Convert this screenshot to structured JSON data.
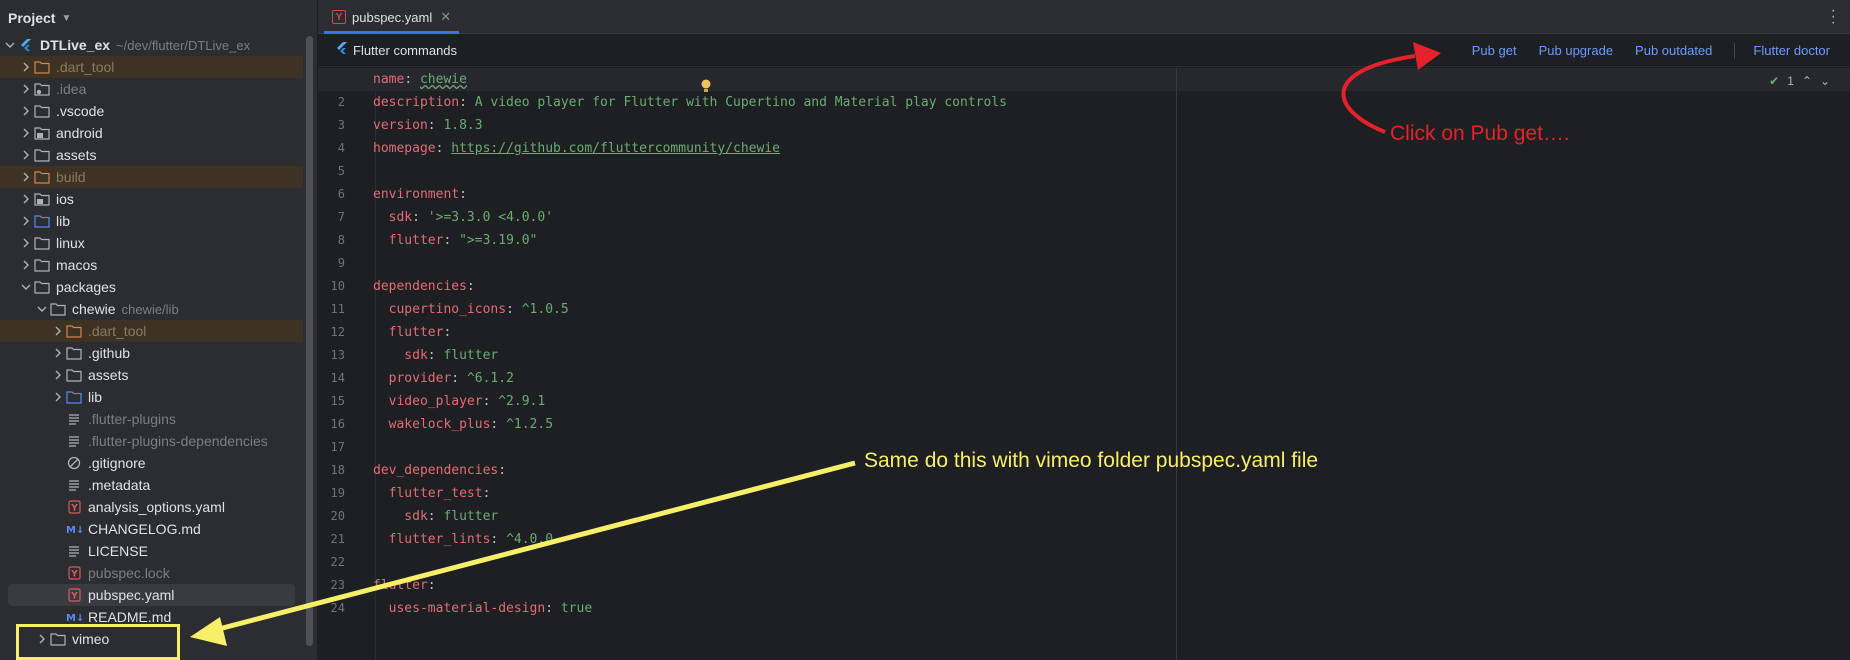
{
  "project_panel": {
    "title": "Project",
    "root_name": "DTLive_ex",
    "root_path": "~/dev/flutter/DTLive_ex",
    "items": [
      {
        "label": ".dart_tool",
        "depth": 1,
        "type": "folder-excluded",
        "arrow": "right",
        "style": "dim",
        "hl": true
      },
      {
        "label": ".idea",
        "depth": 1,
        "type": "folder-settings",
        "arrow": "right",
        "style": "grey"
      },
      {
        "label": ".vscode",
        "depth": 1,
        "type": "folder",
        "arrow": "right"
      },
      {
        "label": "android",
        "depth": 1,
        "type": "folder-module",
        "arrow": "right"
      },
      {
        "label": "assets",
        "depth": 1,
        "type": "folder",
        "arrow": "right"
      },
      {
        "label": "build",
        "depth": 1,
        "type": "folder-excluded",
        "arrow": "right",
        "style": "dim",
        "hl": true
      },
      {
        "label": "ios",
        "depth": 1,
        "type": "folder-module",
        "arrow": "right"
      },
      {
        "label": "lib",
        "depth": 1,
        "type": "folder-source",
        "arrow": "right"
      },
      {
        "label": "linux",
        "depth": 1,
        "type": "folder",
        "arrow": "right"
      },
      {
        "label": "macos",
        "depth": 1,
        "type": "folder",
        "arrow": "right"
      },
      {
        "label": "packages",
        "depth": 1,
        "type": "folder",
        "arrow": "down"
      },
      {
        "label": "chewie",
        "hint": "chewie/lib",
        "depth": 2,
        "type": "folder",
        "arrow": "down"
      },
      {
        "label": ".dart_tool",
        "depth": 3,
        "type": "folder-excluded",
        "arrow": "right",
        "style": "dim",
        "hl": true
      },
      {
        "label": ".github",
        "depth": 3,
        "type": "folder",
        "arrow": "right"
      },
      {
        "label": "assets",
        "depth": 3,
        "type": "folder",
        "arrow": "right"
      },
      {
        "label": "lib",
        "depth": 3,
        "type": "folder-source",
        "arrow": "right"
      },
      {
        "label": ".flutter-plugins",
        "depth": 3,
        "type": "file-text",
        "style": "grey"
      },
      {
        "label": ".flutter-plugins-dependencies",
        "depth": 3,
        "type": "file-text",
        "style": "grey"
      },
      {
        "label": ".gitignore",
        "depth": 3,
        "type": "file-ignore"
      },
      {
        "label": ".metadata",
        "depth": 3,
        "type": "file-text"
      },
      {
        "label": "analysis_options.yaml",
        "depth": 3,
        "type": "file-yaml"
      },
      {
        "label": "CHANGELOG.md",
        "depth": 3,
        "type": "file-md"
      },
      {
        "label": "LICENSE",
        "depth": 3,
        "type": "file-text"
      },
      {
        "label": "pubspec.lock",
        "depth": 3,
        "type": "file-yaml",
        "style": "grey"
      },
      {
        "label": "pubspec.yaml",
        "depth": 3,
        "type": "file-yaml",
        "selected": true
      },
      {
        "label": "README.md",
        "depth": 3,
        "type": "file-md"
      },
      {
        "label": "vimeo",
        "depth": 2,
        "type": "folder",
        "arrow": "right"
      }
    ]
  },
  "editor": {
    "tab_label": "pubspec.yaml",
    "commands_title": "Flutter commands",
    "commands": [
      "Pub get",
      "Pub upgrade",
      "Pub outdated"
    ],
    "doctor": "Flutter doctor",
    "inspection_count": "1",
    "lines": [
      [
        {
          "t": "name",
          "c": "k2"
        },
        {
          "t": ": ",
          "c": "p"
        },
        {
          "t": "chewie",
          "c": "v wavy"
        }
      ],
      [
        {
          "t": "description",
          "c": "k2"
        },
        {
          "t": ": ",
          "c": "p"
        },
        {
          "t": "A video player for Flutter with Cupertino and Material play controls",
          "c": "v"
        }
      ],
      [
        {
          "t": "version",
          "c": "k2"
        },
        {
          "t": ": ",
          "c": "p"
        },
        {
          "t": "1.8.3",
          "c": "v"
        }
      ],
      [
        {
          "t": "homepage",
          "c": "k2"
        },
        {
          "t": ": ",
          "c": "p"
        },
        {
          "t": "https://github.com/fluttercommunity/chewie",
          "c": "u"
        }
      ],
      [],
      [
        {
          "t": "environment",
          "c": "k2"
        },
        {
          "t": ":",
          "c": "p"
        }
      ],
      [
        {
          "t": "  sdk",
          "c": "k2"
        },
        {
          "t": ": ",
          "c": "p"
        },
        {
          "t": "'>=3.3.0 <4.0.0'",
          "c": "v"
        }
      ],
      [
        {
          "t": "  flutter",
          "c": "k2"
        },
        {
          "t": ": ",
          "c": "p"
        },
        {
          "t": "\">=3.19.0\"",
          "c": "v"
        }
      ],
      [],
      [
        {
          "t": "dependencies",
          "c": "k2"
        },
        {
          "t": ":",
          "c": "p"
        }
      ],
      [
        {
          "t": "  cupertino_icons",
          "c": "k2"
        },
        {
          "t": ": ",
          "c": "p"
        },
        {
          "t": "^1.0.5",
          "c": "v"
        }
      ],
      [
        {
          "t": "  flutter",
          "c": "k2"
        },
        {
          "t": ":",
          "c": "p"
        }
      ],
      [
        {
          "t": "    sdk",
          "c": "k2"
        },
        {
          "t": ": ",
          "c": "p"
        },
        {
          "t": "flutter",
          "c": "v"
        }
      ],
      [
        {
          "t": "  provider",
          "c": "k2"
        },
        {
          "t": ": ",
          "c": "p"
        },
        {
          "t": "^6.1.2",
          "c": "v"
        }
      ],
      [
        {
          "t": "  video_player",
          "c": "k2"
        },
        {
          "t": ": ",
          "c": "p"
        },
        {
          "t": "^2.9.1",
          "c": "v"
        }
      ],
      [
        {
          "t": "  wakelock_plus",
          "c": "k2"
        },
        {
          "t": ": ",
          "c": "p"
        },
        {
          "t": "^1.2.5",
          "c": "v"
        }
      ],
      [],
      [
        {
          "t": "dev_dependencies",
          "c": "k2"
        },
        {
          "t": ":",
          "c": "p"
        }
      ],
      [
        {
          "t": "  flutter_test",
          "c": "k2"
        },
        {
          "t": ":",
          "c": "p"
        }
      ],
      [
        {
          "t": "    sdk",
          "c": "k2"
        },
        {
          "t": ": ",
          "c": "p"
        },
        {
          "t": "flutter",
          "c": "v"
        }
      ],
      [
        {
          "t": "  flutter_lints",
          "c": "k2"
        },
        {
          "t": ": ",
          "c": "p"
        },
        {
          "t": "^4.0.0",
          "c": "v"
        }
      ],
      [],
      [
        {
          "t": "flutter",
          "c": "k2"
        },
        {
          "t": ":",
          "c": "p"
        }
      ],
      [
        {
          "t": "  uses-material-design",
          "c": "k2"
        },
        {
          "t": ": ",
          "c": "p"
        },
        {
          "t": "true",
          "c": "v"
        }
      ]
    ]
  },
  "annotations": {
    "red_text": "Click on Pub get….",
    "yellow_text": "Same do this with vimeo folder pubspec.yaml file",
    "red_color": "#e5222b",
    "yellow_color": "#f7ee6a"
  },
  "colors": {
    "accent": "#3574f0",
    "link": "#6b9bfa",
    "yaml_key": "#e06c75",
    "yaml_value": "#6aab73"
  }
}
